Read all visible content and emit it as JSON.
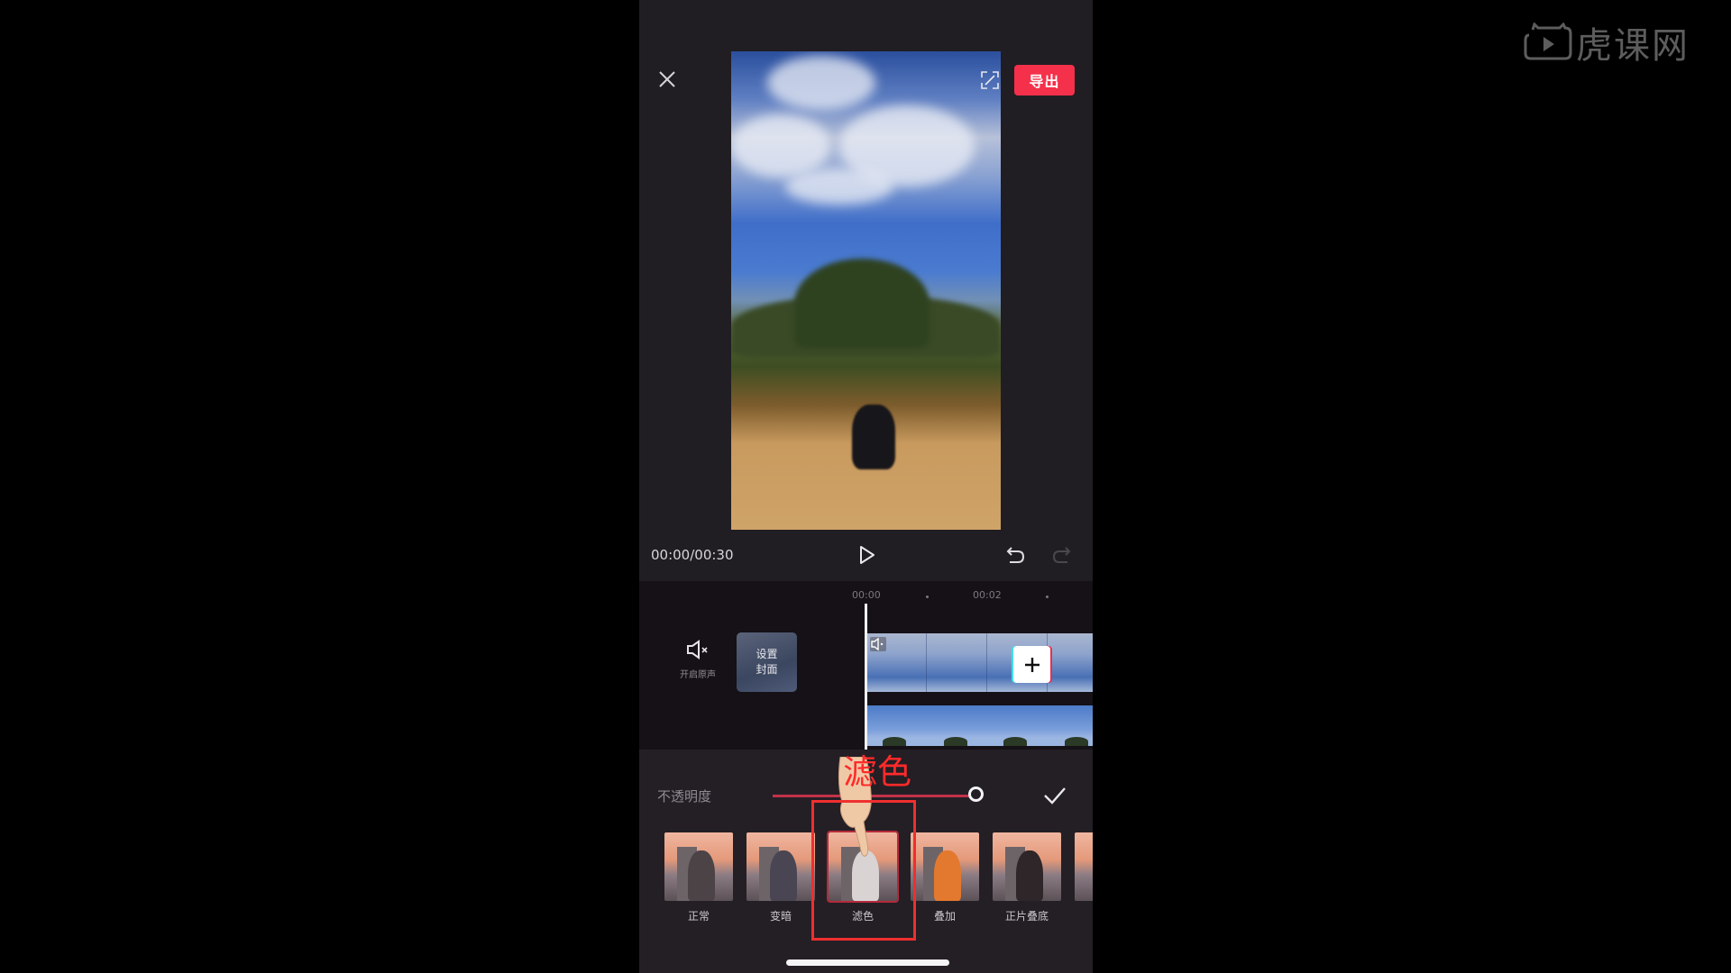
{
  "watermark": {
    "logo_text": "虎课网",
    "icon": "tiger-play-icon"
  },
  "top_bar": {
    "close_icon": "close-icon",
    "export_label": "导出",
    "export_color": "#f5304a",
    "fullscreen_icon": "fullscreen-icon"
  },
  "player": {
    "timecode": "00:00/00:30",
    "play_icon": "play-icon",
    "undo_icon": "undo-icon",
    "redo_icon": "redo-icon"
  },
  "timeline": {
    "ruler": [
      "00:00",
      "00:02"
    ],
    "mute": {
      "icon": "speaker-mute-icon",
      "label": "开启原声"
    },
    "cover": {
      "line1": "设置",
      "line2": "封面"
    },
    "add_clip_label": "+"
  },
  "blend_panel": {
    "opacity_label": "不透明度",
    "opacity_value_percent": 100,
    "confirm_icon": "check-icon",
    "modes": [
      {
        "label": "正常",
        "selected": false
      },
      {
        "label": "变暗",
        "selected": false
      },
      {
        "label": "滤色",
        "selected": true
      },
      {
        "label": "叠加",
        "selected": false
      },
      {
        "label": "正片叠底",
        "selected": false
      }
    ]
  },
  "annotation": {
    "text": "滤色",
    "color": "#ef2f2f"
  }
}
